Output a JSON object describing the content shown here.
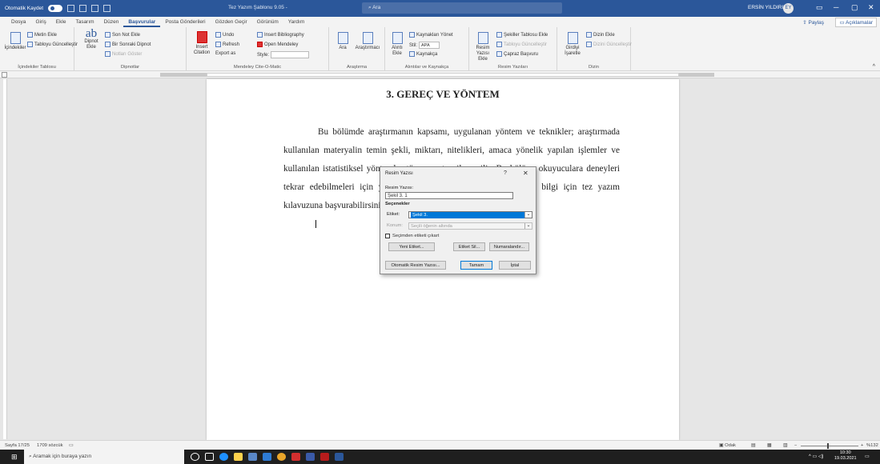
{
  "titlebar": {
    "autosave": "Otomatik Kaydet",
    "doc_title": "Tez Yazım Şablonu 9.05 -",
    "search": "Ara",
    "user": "ERSİN YILDIRIM",
    "user_initials": "EY"
  },
  "tabs": [
    "Dosya",
    "Giriş",
    "Ekle",
    "Tasarım",
    "Düzen",
    "Başvurular",
    "Posta Gönderileri",
    "Gözden Geçir",
    "Görünüm",
    "Yardım"
  ],
  "active_tab": "Başvurular",
  "share": "Paylaş",
  "comments": "Açıklamalar",
  "ribbon": {
    "toc": {
      "big": "İçindekiler",
      "add_text": "Metin Ekle",
      "update": "Tabloyu Güncelleştir",
      "label": "İçindekiler Tablosu"
    },
    "footnotes": {
      "insert": "Dipnot Ekle",
      "endnote": "Son Not Ekle",
      "next": "Bir Sonraki Dipnot",
      "show": "Notları Göster",
      "label": "Dipnotlar"
    },
    "mendeley": {
      "insert": "Insert Citation",
      "undo": "Undo",
      "refresh": "Refresh",
      "export": "Export as",
      "bib": "Insert Bibliography",
      "open": "Open Mendeley",
      "style": "Style:",
      "label": "Mendeley Cite-O-Matic"
    },
    "research": {
      "search": "Ara",
      "researcher": "Araştırmacı",
      "label": "Araştırma"
    },
    "citations": {
      "insert": "Alıntı Ekle",
      "manage": "Kaynakları Yönet",
      "style": "Stil:",
      "style_value": "APA",
      "bibliography": "Kaynakça",
      "label": "Alıntılar ve Kaynakça"
    },
    "captions": {
      "insert": "Resim Yazısı Ekle",
      "figures_table": "Şekiller Tablosu Ekle",
      "update": "Tabloyu Güncelleştir",
      "cross_ref": "Çapraz Başvuru",
      "label": "Resim Yazıları"
    },
    "index": {
      "mark": "Girdiyi İşaretle",
      "insert": "Dizin Ekle",
      "update": "Dizini Güncelleştir",
      "label": "Dizin"
    }
  },
  "document": {
    "heading": "3. GEREÇ VE YÖNTEM",
    "paragraph": "Bu bölümde araştırmanın kapsamı, uygulanan yöntem ve teknikler; araştırmada kullanılan materyalin temin şekli, miktarı, nitelikleri, amaca yönelik yapılan işlemler ve kullanılan istatistiksel yöntemler tüm ayrıntısı ile verilir. Bu bölüm, okuyuculara deneyleri tekrar edebilmeleri için yeterli ayrıntıda bilgi vermelidir. Detaylı bilgi için tez yazım kılavuzuna başvurabilirsiniz."
  },
  "dialog": {
    "title": "Resim Yazısı",
    "help": "?",
    "close": "✕",
    "caption_label": "Resim Yazısı:",
    "caption_value": "Şekil 3. 1",
    "options_label": "Seçenekler",
    "label_label": "Etiket:",
    "label_value": "Şekil 3.",
    "position_label": "Konum:",
    "position_value": "Seçili öğenin altında",
    "exclude_label": "Seçimden etiketi çıkart",
    "new_label_btn": "Yeni Etiket...",
    "delete_label_btn": "Etiket Sil...",
    "numbering_btn": "Numaralandır...",
    "autocaption_btn": "Otomatik Resim Yazısı...",
    "ok_btn": "Tamam",
    "cancel_btn": "İptal"
  },
  "status": {
    "page": "Sayfa 17/25",
    "words": "1709 sözcük",
    "focus": "Odak",
    "zoom": "%132"
  },
  "taskbar": {
    "search": "Aramak için buraya yazın",
    "time": "10:30",
    "date": "19.03.2021"
  },
  "colors": {
    "accent": "#2b579a",
    "selection": "#0078d7"
  }
}
